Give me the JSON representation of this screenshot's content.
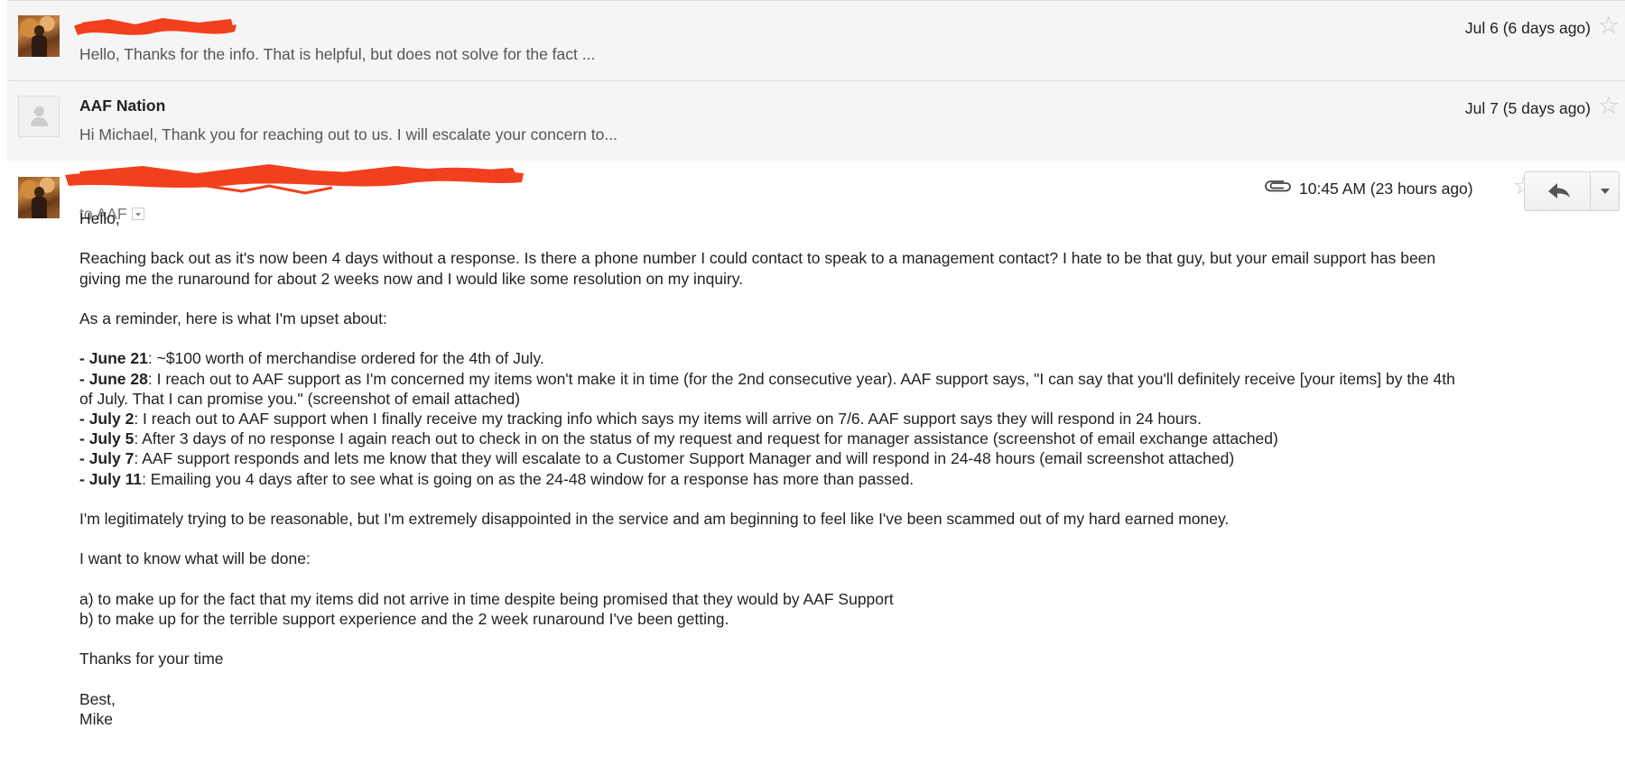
{
  "messages": [
    {
      "sender": "",
      "sender_redacted": true,
      "snippet": "Hello, Thanks for the info. That is helpful, but does not solve for the fact ...",
      "date": "Jul 6 (6 days ago)",
      "avatar": "photo-avatar",
      "star_icon": "star-outline-icon"
    },
    {
      "sender": "AAF Nation",
      "snippet": "Hi Michael, Thank you for reaching out to us. I will escalate your concern to...",
      "date": "Jul 7 (5 days ago)",
      "avatar": "default-person-icon",
      "star_icon": "star-outline-icon"
    }
  ],
  "open_message": {
    "sender": "",
    "sender_redacted": true,
    "to": "to AAF",
    "time": "10:45 AM (23 hours ago)",
    "attachment_icon": "paperclip-icon",
    "reply_icon": "reply-icon",
    "more_icon": "chevron-down-icon",
    "body": {
      "greeting": "Hello,",
      "p1": "Reaching back out as it's now been 4 days without a response. Is there a phone number I could contact to speak to a management contact? I hate to be that guy, but your email support has been",
      "p1b": "giving me the runaround for about 2 weeks now and I would like some resolution on my inquiry.",
      "p2": "As a reminder, here is what I'm upset about:",
      "timeline": [
        {
          "date": "- June 21",
          "text": ": ~$100 worth of merchandise ordered for the 4th of July."
        },
        {
          "date": "- June 28",
          "text": ": I reach out to AAF support as I'm concerned my items won't make it in time (for the 2nd consecutive year). AAF support says, \"I can say that you'll definitely receive [your items] by the 4th",
          "cont": "of July. That I can promise you.\" (screenshot of email attached)"
        },
        {
          "date": "- July 2",
          "text": ": I reach out to AAF support when I finally receive my tracking info which says my items will arrive on 7/6. AAF support says they will respond in 24 hours."
        },
        {
          "date": "- July 5",
          "text": ": After 3 days of no response I again reach out to check in on the status of my request and request for manager assistance (screenshot of email exchange attached)"
        },
        {
          "date": "- July 7",
          "text": ": AAF support responds and lets me know that they will escalate to a Customer Support Manager and will respond in 24-48 hours (email screenshot attached)"
        },
        {
          "date": "- July 11",
          "text": ": Emailing you 4 days after to see what is going on as the 24-48 window for a response has more than passed."
        }
      ],
      "p3": "I'm legitimately trying to be reasonable, but I'm extremely disappointed in the service and am beginning to feel like I've been scammed out of my hard earned money.",
      "p4": "I want to know what will be done:",
      "list_a": "a) to make up for the fact that my items did not arrive in time despite being promised that they would by AAF Support",
      "list_b": "b) to make up for the terrible support experience and the 2 week runaround I've been getting.",
      "p5": "Thanks for your time",
      "signoff": "Best,",
      "signature": "Mike"
    }
  },
  "colors": {
    "redaction": "#f2401e",
    "collapsed_bg": "#f5f5f5",
    "star": "#c8c8c8"
  }
}
